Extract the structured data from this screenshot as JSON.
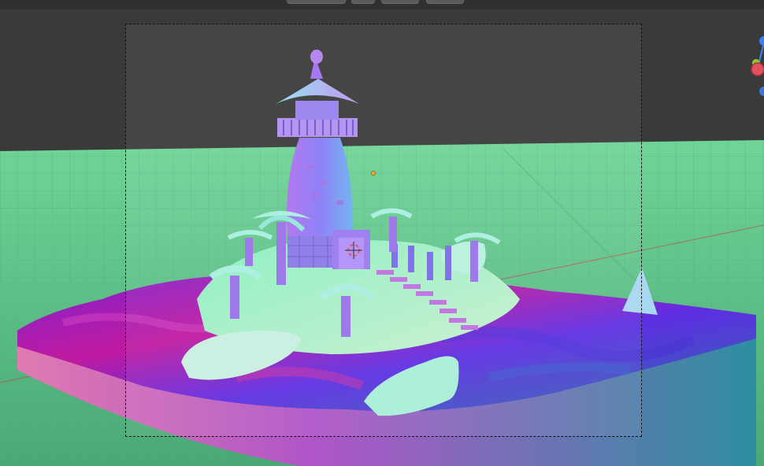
{
  "viewport": {
    "background": "#3a3a3a",
    "floor_color": "#5fbf84",
    "grid_color": "#4fa873",
    "water_colors": [
      "#8a1fd6",
      "#c21aa8",
      "#5a2be0",
      "#2a8aa0"
    ],
    "island_color": "#9ef0b8",
    "lighthouse_color": "#8f6cf0"
  },
  "gizmo": {
    "axes": [
      {
        "name": "z-axis",
        "color": "#3b82f6"
      },
      {
        "name": "y-axis",
        "color": "#8ac926"
      },
      {
        "name": "x-axis",
        "color": "#e05260"
      }
    ]
  },
  "header": {
    "buttons": [
      "view-mode",
      "shading",
      "overlay",
      "gizmo-toggle"
    ]
  }
}
